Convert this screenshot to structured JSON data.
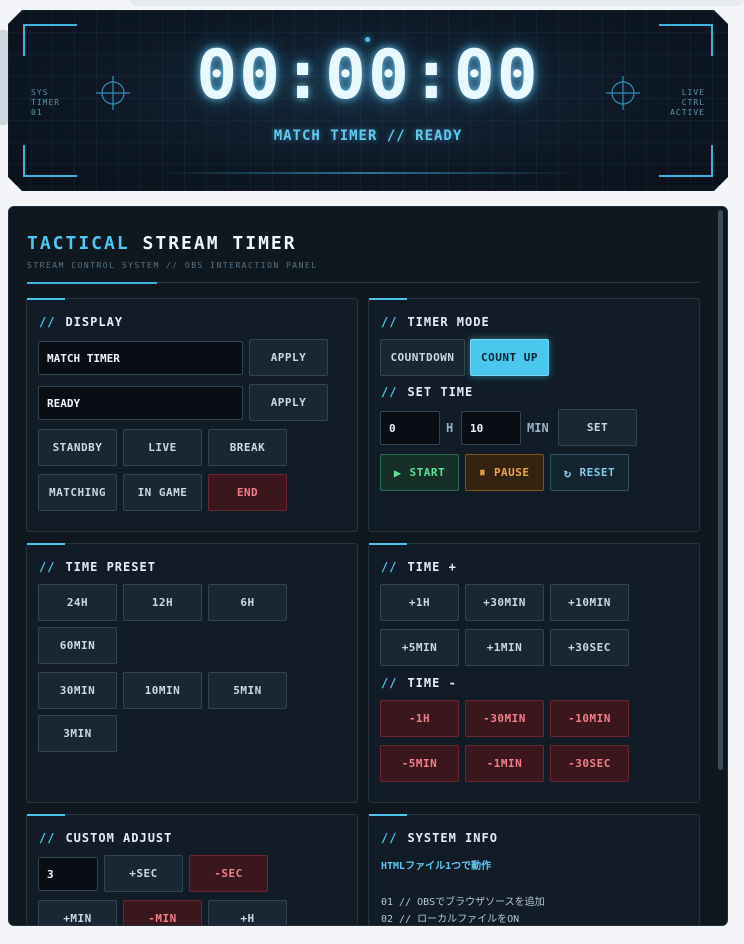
{
  "display": {
    "time": "00:00:00",
    "status": "MATCH TIMER // READY",
    "left_lines": [
      "SYS",
      "TIMER",
      "01"
    ],
    "right_lines": [
      "LIVE",
      "CTRL",
      "ACTIVE"
    ]
  },
  "panel": {
    "title_accent": "TACTICAL",
    "title_main": "STREAM TIMER",
    "subtitle": "STREAM CONTROL SYSTEM // OBS INTERACTION PANEL"
  },
  "display_section": {
    "slashes": "//",
    "title": "DISPLAY",
    "field1_value": "MATCH TIMER",
    "field2_value": "READY",
    "apply_label": "APPLY",
    "status_buttons": [
      "STANDBY",
      "LIVE",
      "BREAK",
      "MATCHING",
      "IN GAME",
      "END"
    ]
  },
  "timer_mode": {
    "title": "TIMER MODE",
    "countdown_label": "COUNTDOWN",
    "countup_label": "COUNT UP",
    "set_time_title": "SET TIME",
    "hours_value": "0",
    "hours_unit": "H",
    "minutes_value": "10",
    "minutes_unit": "MIN",
    "set_label": "SET",
    "start_label": "START",
    "pause_label": "PAUSE",
    "reset_label": "RESET"
  },
  "time_preset": {
    "title": "TIME PRESET",
    "row1": [
      "24H",
      "12H",
      "6H"
    ],
    "row2": [
      "60MIN"
    ],
    "row3": [
      "30MIN",
      "10MIN",
      "5MIN"
    ],
    "row4": [
      "3MIN"
    ]
  },
  "time_plus": {
    "title": "TIME +",
    "buttons": [
      "+1H",
      "+30MIN",
      "+10MIN",
      "+5MIN",
      "+1MIN",
      "+30SEC"
    ]
  },
  "time_minus": {
    "title": "TIME -",
    "buttons": [
      "-1H",
      "-30MIN",
      "-10MIN",
      "-5MIN",
      "-1MIN",
      "-30SEC"
    ]
  },
  "custom_adjust": {
    "title": "CUSTOM ADJUST",
    "value": "3",
    "buttons": [
      "+SEC",
      "-SEC",
      "+MIN",
      "-MIN",
      "+H"
    ]
  },
  "system_info": {
    "title": "SYSTEM INFO",
    "headline": "HTMLファイル1つで動作",
    "lines": [
      "01 // OBSでブラウザソースを追加",
      "02 // ローカルファイルをON"
    ]
  },
  "colors": {
    "accent": "#4ec3ea",
    "danger": "#f07f8b",
    "start": "#5ee09a",
    "pause": "#f0a646"
  }
}
